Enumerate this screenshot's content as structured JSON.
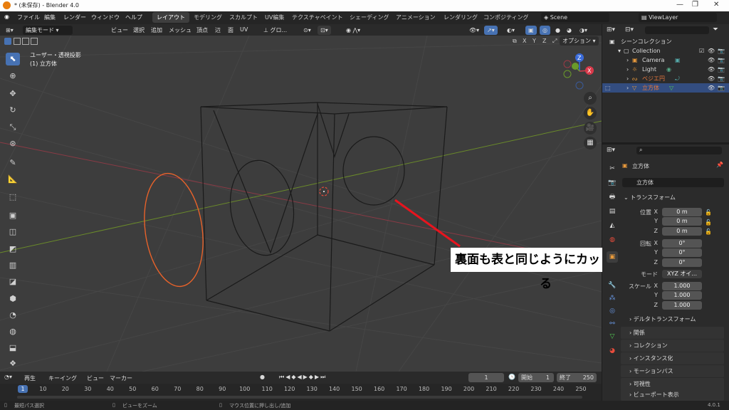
{
  "window": {
    "title": "* (未保存) - Blender 4.0"
  },
  "menu": [
    "ファイル",
    "編集",
    "レンダー",
    "ウィンドウ",
    "ヘルプ"
  ],
  "workspaces": [
    "レイアウト",
    "モデリング",
    "スカルプト",
    "UV編集",
    "テクスチャペイント",
    "シェーディング",
    "アニメーション",
    "レンダリング",
    "コンポジティング"
  ],
  "active_workspace": "レイアウト",
  "scene": "Scene",
  "view_layer": "ViewLayer",
  "viewport_header": {
    "mode": "編集モード",
    "items": [
      "ビュー",
      "選択",
      "追加",
      "メッシュ",
      "頂点",
      "辺",
      "面",
      "UV"
    ],
    "transform": "グロ...",
    "axes": [
      "X",
      "Y",
      "Z"
    ],
    "options": "オプション"
  },
  "viewport": {
    "view_name": "ユーザー・透視投影",
    "object_label": "(1) 立方体"
  },
  "annotation": "裏面も表と同じようにカットされる",
  "outliner": {
    "root": "シーンコレクション",
    "collection": "Collection",
    "items": [
      {
        "name": "Camera",
        "color": "#e89a3c"
      },
      {
        "name": "Light",
        "color": "#e89a3c"
      },
      {
        "name": "ベジエ円",
        "color": "#e8773c"
      },
      {
        "name": "立方体",
        "color": "#e8773c"
      }
    ]
  },
  "properties": {
    "object_name": "立方体",
    "data_name": "立方体",
    "transform_title": "トランスフォーム",
    "location": {
      "label": "位置",
      "x": "0 m",
      "y": "0 m",
      "z": "0 m"
    },
    "rotation": {
      "label": "回転",
      "x": "0°",
      "y": "0°",
      "z": "0°"
    },
    "mode": {
      "label": "モード",
      "value": "XYZ オイ..."
    },
    "scale": {
      "label": "スケール",
      "x": "1.000",
      "y": "1.000",
      "z": "1.000"
    },
    "axis_labels": [
      "X",
      "Y",
      "Z"
    ],
    "delta": "デルタトランスフォーム",
    "sections": [
      "関係",
      "コレクション",
      "インスタンス化",
      "モーションパス",
      "可視性",
      "ビューポート表示"
    ]
  },
  "timeline": {
    "menus": [
      "再生",
      "キーイング",
      "ビュー",
      "マーカー"
    ],
    "current_frame": "1",
    "start_label": "開始",
    "start": "1",
    "end_label": "終了",
    "end": "250",
    "ticks": [
      "1",
      "10",
      "20",
      "30",
      "40",
      "50",
      "60",
      "70",
      "80",
      "90",
      "100",
      "110",
      "120",
      "130",
      "140",
      "150",
      "160",
      "170",
      "180",
      "190",
      "200",
      "210",
      "220",
      "230",
      "240",
      "250"
    ]
  },
  "status": {
    "left": "最短パス選択",
    "middle": "ビューをズーム",
    "right": "マウス位置に押し出し/追加",
    "version": "4.0.1"
  }
}
